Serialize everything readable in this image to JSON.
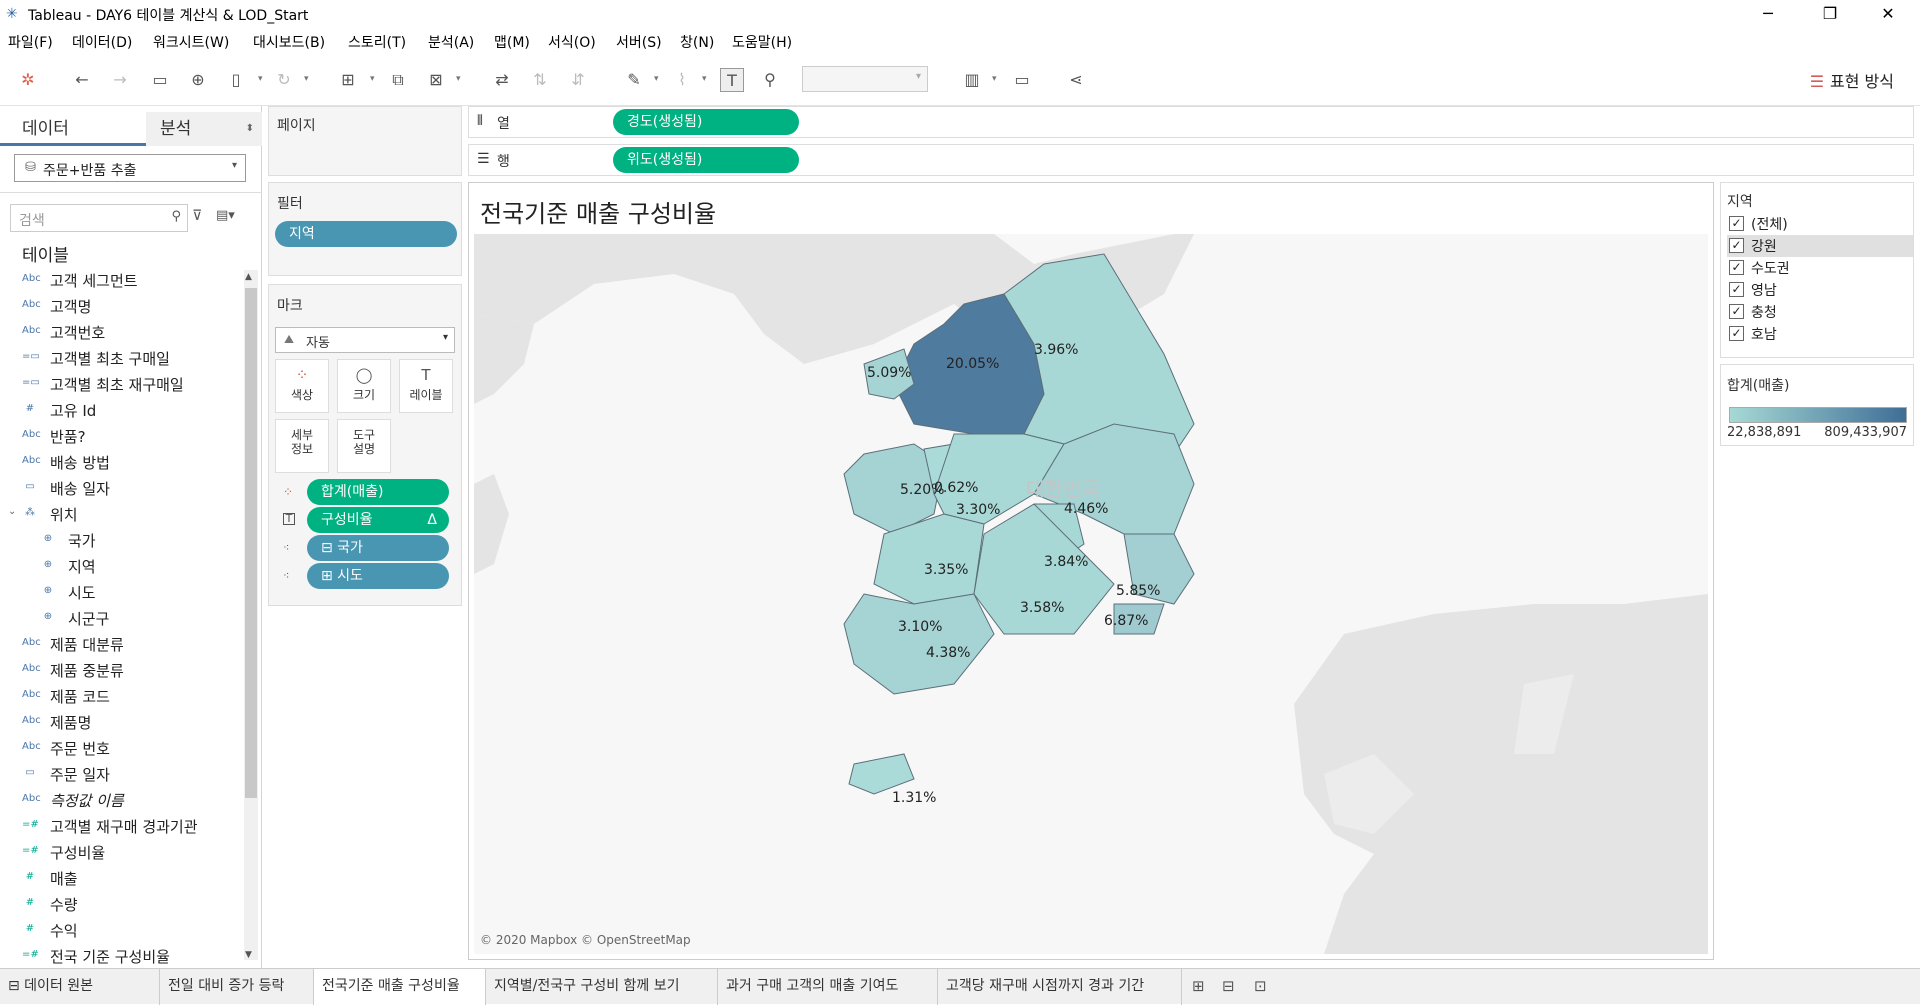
{
  "window": {
    "title": "Tableau - DAY6 테이블 계산식 & LOD_Start"
  },
  "menu": [
    "파일(F)",
    "데이터(D)",
    "워크시트(W)",
    "대시보드(B)",
    "스토리(T)",
    "분석(A)",
    "맵(M)",
    "서식(O)",
    "서버(S)",
    "창(N)",
    "도움말(H)"
  ],
  "toolbar": {
    "show_me": "표현 방식"
  },
  "left": {
    "tab_data": "데이터",
    "tab_analysis": "분석",
    "datasource": "주문+반품 추출",
    "search_placeholder": "검색",
    "tables_header": "테이블",
    "fields": [
      {
        "type": "Abc",
        "name": "고객 세그먼트",
        "kind": "dim"
      },
      {
        "type": "Abc",
        "name": "고객명",
        "kind": "dim"
      },
      {
        "type": "Abc",
        "name": "고객번호",
        "kind": "dim"
      },
      {
        "type": "=▭",
        "name": "고객별 최초 구매일",
        "kind": "dim"
      },
      {
        "type": "=▭",
        "name": "고객별 최초 재구매일",
        "kind": "dim"
      },
      {
        "type": "#",
        "name": "고유 Id",
        "kind": "dim"
      },
      {
        "type": "Abc",
        "name": "반품?",
        "kind": "dim"
      },
      {
        "type": "Abc",
        "name": "배송 방법",
        "kind": "dim"
      },
      {
        "type": "▭",
        "name": "배송 일자",
        "kind": "dim"
      },
      {
        "type": "⁂",
        "name": "위치",
        "kind": "dim",
        "group": true
      },
      {
        "type": "⊕",
        "name": "국가",
        "kind": "dim",
        "child": true
      },
      {
        "type": "⊕",
        "name": "지역",
        "kind": "dim",
        "child": true
      },
      {
        "type": "⊕",
        "name": "시도",
        "kind": "dim",
        "child": true
      },
      {
        "type": "⊕",
        "name": "시군구",
        "kind": "dim",
        "child": true
      },
      {
        "type": "Abc",
        "name": "제품 대분류",
        "kind": "dim"
      },
      {
        "type": "Abc",
        "name": "제품 중분류",
        "kind": "dim"
      },
      {
        "type": "Abc",
        "name": "제품 코드",
        "kind": "dim"
      },
      {
        "type": "Abc",
        "name": "제품명",
        "kind": "dim"
      },
      {
        "type": "Abc",
        "name": "주문 번호",
        "kind": "dim"
      },
      {
        "type": "▭",
        "name": "주문 일자",
        "kind": "dim"
      },
      {
        "type": "Abc",
        "name": "측정값 이름",
        "kind": "dim",
        "italic": true
      },
      {
        "type": "=#",
        "name": "고객별 재구매 경과기관",
        "kind": "meas"
      },
      {
        "type": "=#",
        "name": "구성비율",
        "kind": "meas"
      },
      {
        "type": "#",
        "name": "매출",
        "kind": "meas"
      },
      {
        "type": "#",
        "name": "수량",
        "kind": "meas"
      },
      {
        "type": "#",
        "name": "수익",
        "kind": "meas"
      },
      {
        "type": "=#",
        "name": "전국 기준 구성비율",
        "kind": "meas"
      }
    ]
  },
  "shelves": {
    "pages_label": "페이지",
    "filters_label": "필터",
    "filter_pill": "지역",
    "marks_label": "마크",
    "mark_type": "자동",
    "mark_buttons": [
      "색상",
      "크기",
      "레이블",
      "세부\n정보",
      "도구\n설명"
    ],
    "mark_pills": [
      {
        "icon": "color",
        "label": "합계(매출)",
        "color": "green"
      },
      {
        "icon": "label",
        "label": "구성비율",
        "color": "green",
        "delta": "Δ"
      },
      {
        "icon": "detail",
        "label": "⊟ 국가",
        "color": "blue"
      },
      {
        "icon": "detail",
        "label": "⊞ 시도",
        "color": "blue"
      }
    ],
    "columns_label": "열",
    "columns_pill": "경도(생성됨)",
    "rows_label": "행",
    "rows_pill": "위도(생성됨)"
  },
  "sheet": {
    "title": "전국기준 매출 구성비율",
    "map_credit": "© 2020 Mapbox © OpenStreetMap",
    "country_watermark": "대한민국"
  },
  "chart_data": {
    "type": "map",
    "regions": [
      {
        "label": "20.05%",
        "value": 20.05,
        "color": "#4f7b9f"
      },
      {
        "label": "5.09%",
        "value": 5.09,
        "color": "#a6d3d4"
      },
      {
        "label": "3.96%",
        "value": 3.96,
        "color": "#a8d8d6"
      },
      {
        "label": "5.20%",
        "value": 5.2,
        "color": "#a5d2d3"
      },
      {
        "label": "0.62%",
        "value": 0.62,
        "color": "#abdbd8"
      },
      {
        "label": "3.30%",
        "value": 3.3,
        "color": "#a9d9d6"
      },
      {
        "label": "4.46%",
        "value": 4.46,
        "color": "#a6d4d4"
      },
      {
        "label": "3.84%",
        "value": 3.84,
        "color": "#a8d8d6"
      },
      {
        "label": "3.35%",
        "value": 3.35,
        "color": "#a9d9d6"
      },
      {
        "label": "3.58%",
        "value": 3.58,
        "color": "#a8d8d6"
      },
      {
        "label": "5.85%",
        "value": 5.85,
        "color": "#a3cfd2"
      },
      {
        "label": "6.87%",
        "value": 6.87,
        "color": "#9fcbd0"
      },
      {
        "label": "3.10%",
        "value": 3.1,
        "color": "#a9d9d6"
      },
      {
        "label": "4.38%",
        "value": 4.38,
        "color": "#a6d4d4"
      },
      {
        "label": "1.31%",
        "value": 1.31,
        "color": "#abdbd8"
      }
    ]
  },
  "legend": {
    "region_title": "지역",
    "region_items": [
      {
        "label": "(전체)",
        "checked": true
      },
      {
        "label": "강원",
        "checked": true,
        "highlight": true
      },
      {
        "label": "수도권",
        "checked": true
      },
      {
        "label": "영남",
        "checked": true
      },
      {
        "label": "충청",
        "checked": true
      },
      {
        "label": "호남",
        "checked": true
      }
    ],
    "color_title": "합계(매출)",
    "color_min": "22,838,891",
    "color_max": "809,433,907"
  },
  "tabs": [
    {
      "label": "⊟ 데이터 원본"
    },
    {
      "label": "전일 대비 증가 등락"
    },
    {
      "label": "전국기준 매출 구성비율",
      "active": true
    },
    {
      "label": "지역별/전국구 구성비 함께 보기"
    },
    {
      "label": "과거 구매 고객의 매출 기여도"
    },
    {
      "label": "고객당 재구매 시점까지 경과 기간"
    }
  ]
}
